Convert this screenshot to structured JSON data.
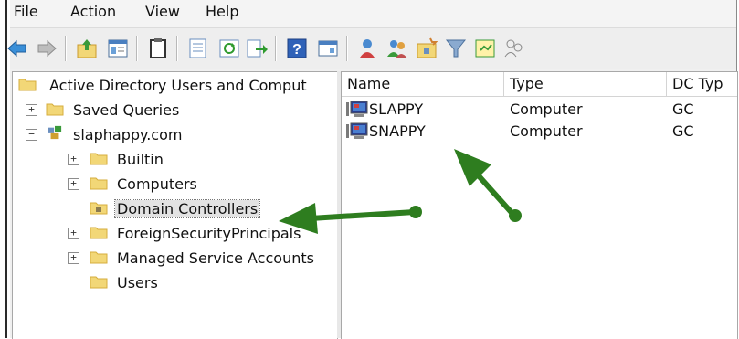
{
  "menubar": {
    "items": [
      "File",
      "Action",
      "View",
      "Help"
    ]
  },
  "toolbar": {
    "buttons": [
      "back-icon",
      "forward-icon",
      "up-folder-icon",
      "show-hide-tree-icon",
      "clipboard-icon",
      "properties-icon",
      "refresh-icon",
      "export-list-icon",
      "help-icon",
      "console-view-icon",
      "new-user-icon",
      "new-group-icon",
      "new-ou-icon",
      "filter-icon",
      "find-icon",
      "add-to-group-icon"
    ]
  },
  "tree": {
    "root": "Active Directory Users and Comput",
    "saved_queries": "Saved Queries",
    "domain": "slaphappy.com",
    "children": {
      "builtin": "Builtin",
      "computers": "Computers",
      "domain_controllers": "Domain Controllers",
      "fsp": "ForeignSecurityPrincipals",
      "msa": "Managed Service Accounts",
      "users": "Users"
    },
    "expander_plus": "+",
    "expander_minus": "−"
  },
  "list": {
    "columns": {
      "name": "Name",
      "type": "Type",
      "dctype": "DC Typ"
    },
    "rows": [
      {
        "name": "SLAPPY",
        "type": "Computer",
        "dctype": "GC"
      },
      {
        "name": "SNAPPY",
        "type": "Computer",
        "dctype": "GC"
      }
    ]
  },
  "annotation": {
    "arrow_color": "#2e7d1f"
  },
  "colors": {
    "folder": "#f2d777",
    "folder_dark": "#d6ad3c",
    "selection": "#e3e3e3"
  }
}
